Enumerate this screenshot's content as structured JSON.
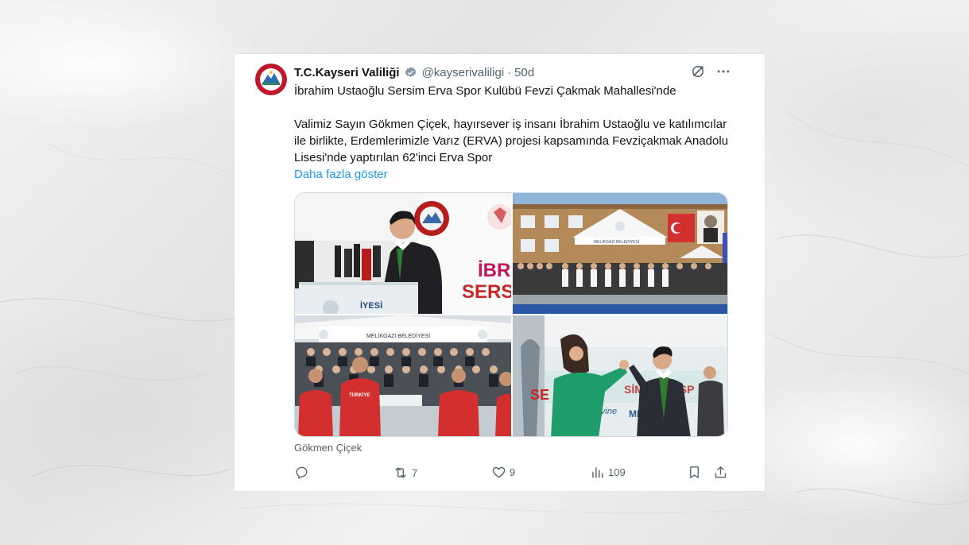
{
  "tweet": {
    "display_name": "T.C.Kayseri Valiliği",
    "handle": "@kayserivaliligi",
    "separator": "·",
    "time": "50d",
    "text_line1": "İbrahim Ustaoğlu Sersim Erva Spor Kulübü Fevzi Çakmak Mahallesi'nde",
    "text_line2": "Valimiz Sayın Gökmen Çiçek, hayırsever iş insanı İbrahim Ustaoğlu ve katılımcılar ile birlikte, Erdemlerimizle Varız (ERVA) projesi kapsamında Fevziçakmak Anadolu Lisesi'nde yaptırılan 62'inci Erva Spor",
    "show_more": "Daha fazla göster",
    "tagged_user": "Gökmen Çiçek"
  },
  "media": {
    "photo1_text_a": "İBR",
    "photo1_text_b": "SERSİM",
    "photo1_text_c": "İYESİ",
    "photo2_text": "MELİKGAZİ BELEDİYESİ",
    "photo3_text_a": "MELİKGAZİ BELEDİYESİ",
    "photo3_shirt": "TÜRKİYE",
    "photo4_text_a": "SE",
    "photo4_text_b": "SİM ERVA SP",
    "photo4_text_c": "erevine",
    "photo4_text_d": "ME"
  },
  "stats": {
    "replies": "",
    "retweets": "7",
    "likes": "9",
    "views": "109"
  },
  "icons": {
    "verified": "verified-badge-icon",
    "grok": "grok-icon",
    "more": "more-icon",
    "reply": "reply-icon",
    "retweet": "retweet-icon",
    "like": "heart-icon",
    "views": "views-icon",
    "bookmark": "bookmark-icon",
    "share": "share-icon"
  },
  "colors": {
    "link": "#1d9bf0",
    "text": "#0f1419",
    "secondary": "#536471"
  }
}
